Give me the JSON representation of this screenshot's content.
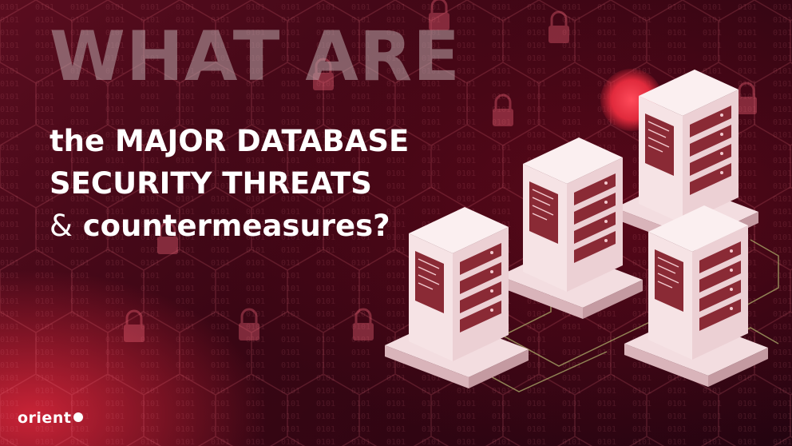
{
  "headline": {
    "big": "WHAT ARE",
    "line1": "the MAJOR DATABASE",
    "line2": "SECURITY THREATS",
    "line3_symbol": "&",
    "line3_rest": "countermeasures?"
  },
  "logo": {
    "text": "orient"
  },
  "colors": {
    "background": "#3a0614",
    "accent": "#e02a3c",
    "server_body": "#f2d6d9",
    "server_drawer": "#8a2a35"
  },
  "icons": [
    "padlock-icon",
    "server-tower-icon"
  ]
}
